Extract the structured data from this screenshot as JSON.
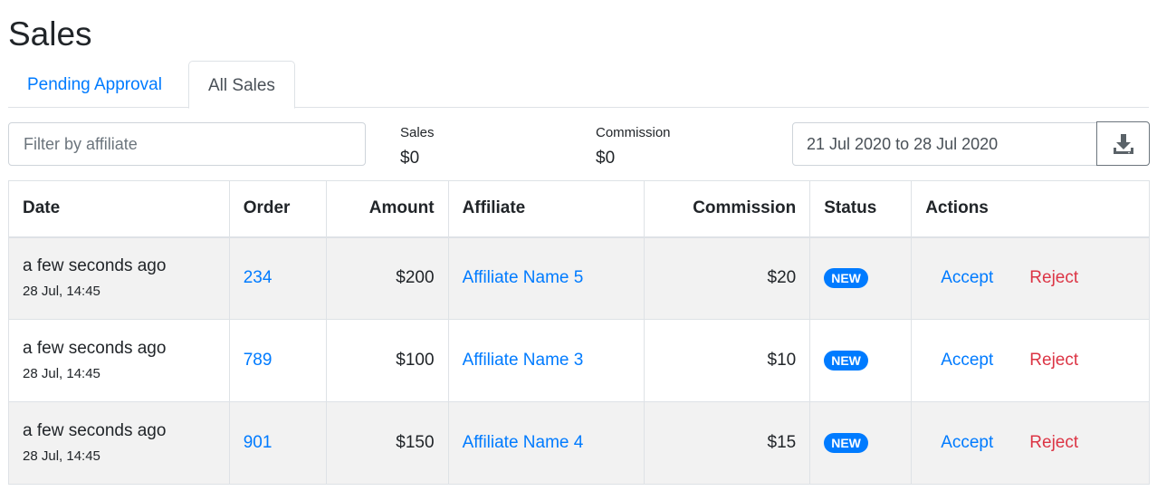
{
  "page": {
    "title": "Sales"
  },
  "tabs": [
    {
      "label": "Pending Approval",
      "active": false
    },
    {
      "label": "All Sales",
      "active": true
    }
  ],
  "filter": {
    "placeholder": "Filter by affiliate",
    "value": ""
  },
  "stats": {
    "sales": {
      "label": "Sales",
      "value": "$0"
    },
    "commission": {
      "label": "Commission",
      "value": "$0"
    }
  },
  "date_range": {
    "value": "21 Jul 2020 to 28 Jul 2020"
  },
  "download": {
    "icon": "download-icon"
  },
  "table": {
    "headers": {
      "date": "Date",
      "order": "Order",
      "amount": "Amount",
      "affiliate": "Affiliate",
      "commission": "Commission",
      "status": "Status",
      "actions": "Actions"
    },
    "rows": [
      {
        "date": "a few seconds ago",
        "time": "28 Jul, 14:45",
        "order": "234",
        "amount": "$200",
        "affiliate": "Affiliate Name 5",
        "commission": "$20",
        "status": "NEW",
        "accept": "Accept",
        "reject": "Reject"
      },
      {
        "date": "a few seconds ago",
        "time": "28 Jul, 14:45",
        "order": "789",
        "amount": "$100",
        "affiliate": "Affiliate Name 3",
        "commission": "$10",
        "status": "NEW",
        "accept": "Accept",
        "reject": "Reject"
      },
      {
        "date": "a few seconds ago",
        "time": "28 Jul, 14:45",
        "order": "901",
        "amount": "$150",
        "affiliate": "Affiliate Name 4",
        "commission": "$15",
        "status": "NEW",
        "accept": "Accept",
        "reject": "Reject"
      }
    ]
  },
  "colors": {
    "link": "#007bff",
    "danger": "#dc3545",
    "badge": "#007bff",
    "stripe": "#f2f2f2"
  }
}
